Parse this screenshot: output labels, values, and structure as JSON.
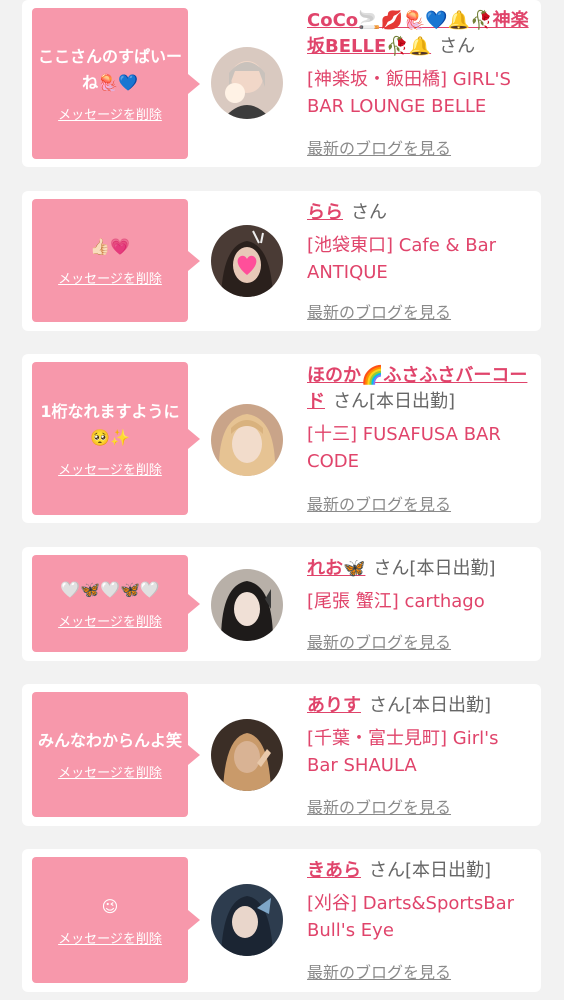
{
  "items": [
    {
      "message": "ここさんのすぱいーね🪼💙",
      "delete_label": "メッセージを削除",
      "name": "CoCo🚬💋🪼💙🔔🥀神楽坂BELLE🥀🔔",
      "suffix": "さん",
      "shop": "[神楽坂・飯田橋] GIRL'S BAR LOUNGE BELLE",
      "blog_label": "最新のブログを見る"
    },
    {
      "message": "👍🏻💗",
      "delete_label": "メッセージを削除",
      "name": "らら",
      "suffix": "さん",
      "shop": "[池袋東口] Cafe & Bar ANTIQUE",
      "blog_label": "最新のブログを見る"
    },
    {
      "message": "1桁なれますように🥺✨",
      "delete_label": "メッセージを削除",
      "name": "ほのか🌈ふさふさバーコード",
      "suffix": "さん[本日出勤]",
      "shop": "[十三] FUSAFUSA BAR CODE",
      "blog_label": "最新のブログを見る"
    },
    {
      "message": "🤍🦋🤍🦋🤍",
      "delete_label": "メッセージを削除",
      "name": "れお🦋",
      "suffix": "さん[本日出勤]",
      "shop": "[尾張 蟹江] carthago",
      "blog_label": "最新のブログを見る"
    },
    {
      "message": "みんなわからんよ笑",
      "delete_label": "メッセージを削除",
      "name": "ありす",
      "suffix": "さん[本日出勤]",
      "shop": "[千葉・富士見町] Girl's Bar SHAULA",
      "blog_label": "最新のブログを見る"
    },
    {
      "message": "😉",
      "delete_label": "メッセージを削除",
      "name": "きあら",
      "suffix": "さん[本日出勤]",
      "shop": "[刈谷] Darts&SportsBar Bull's Eye",
      "blog_label": "最新のブログを見る"
    }
  ]
}
